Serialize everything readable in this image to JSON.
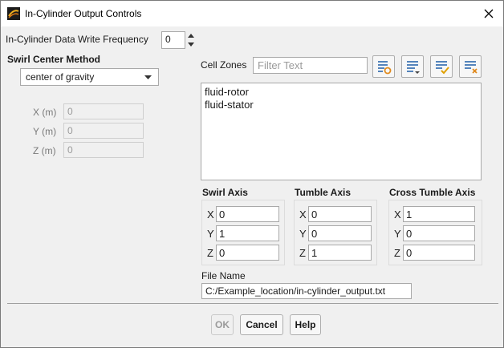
{
  "window": {
    "title": "In-Cylinder Output Controls",
    "icon": "ansys-fluent-app-icon",
    "close_icon": "close-x-icon"
  },
  "write_frequency": {
    "label": "In-Cylinder Data Write Frequency",
    "value": "0"
  },
  "swirl_center": {
    "section_label": "Swirl Center Method",
    "method_selected": "center of gravity",
    "x_label": "X (m)",
    "x_value": "0",
    "y_label": "Y (m)",
    "y_value": "0",
    "z_label": "Z (m)",
    "z_value": "0"
  },
  "cell_zones": {
    "label": "Cell Zones",
    "filter_placeholder": "Filter Text",
    "toolbar_icons": [
      "filter-settings-icon",
      "list-select-dropdown-icon",
      "select-all-icon",
      "deselect-all-icon"
    ],
    "items": [
      "fluid-rotor",
      "fluid-stator"
    ]
  },
  "swirl_axis": {
    "title": "Swirl Axis",
    "x_label": "X",
    "x": "0",
    "y_label": "Y",
    "y": "1",
    "z_label": "Z",
    "z": "0"
  },
  "tumble_axis": {
    "title": "Tumble Axis",
    "x_label": "X",
    "x": "0",
    "y_label": "Y",
    "y": "0",
    "z_label": "Z",
    "z": "1"
  },
  "cross_tumble_axis": {
    "title": "Cross Tumble Axis",
    "x_label": "X",
    "x": "1",
    "y_label": "Y",
    "y": "0",
    "z_label": "Z",
    "z": "0"
  },
  "file_name": {
    "label": "File Name",
    "value": "C:/Example_location/in-cylinder_output.txt"
  },
  "buttons": {
    "ok": "OK",
    "cancel": "Cancel",
    "help": "Help"
  },
  "colors": {
    "background": "#f0f0f0",
    "titlebar": "#ffffff",
    "icon_blue": "#1f5fa8",
    "icon_orange": "#e08a1e",
    "icon_check": "#e0a000"
  }
}
